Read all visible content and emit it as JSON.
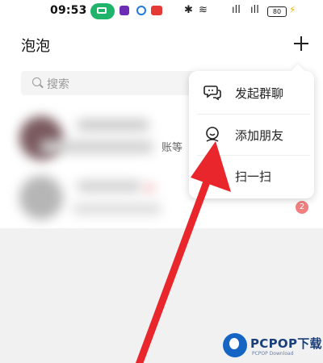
{
  "status_bar": {
    "time": "09:53",
    "bluetooth_glyph": "✱",
    "wifi_glyph": "≋",
    "signal_text": "ıll",
    "battery": "80"
  },
  "header": {
    "title": "泡泡"
  },
  "search": {
    "placeholder": "搜索"
  },
  "conversations": [
    {
      "snippet": "账等",
      "unread": ""
    },
    {
      "snippet": "",
      "unread": "2"
    }
  ],
  "popup_menu": {
    "items": [
      {
        "label": "发起群聊",
        "icon": "group-chat-icon"
      },
      {
        "label": "添加朋友",
        "icon": "add-friend-icon"
      },
      {
        "label": "扫一扫",
        "icon": "scan-icon"
      }
    ]
  },
  "watermark": {
    "brand": "PCPOP下载",
    "sub": "PCPOP Download"
  },
  "colors": {
    "arrow": "#e8262b",
    "accent_green": "#1fb46a",
    "watermark_blue": "#1664c4"
  }
}
